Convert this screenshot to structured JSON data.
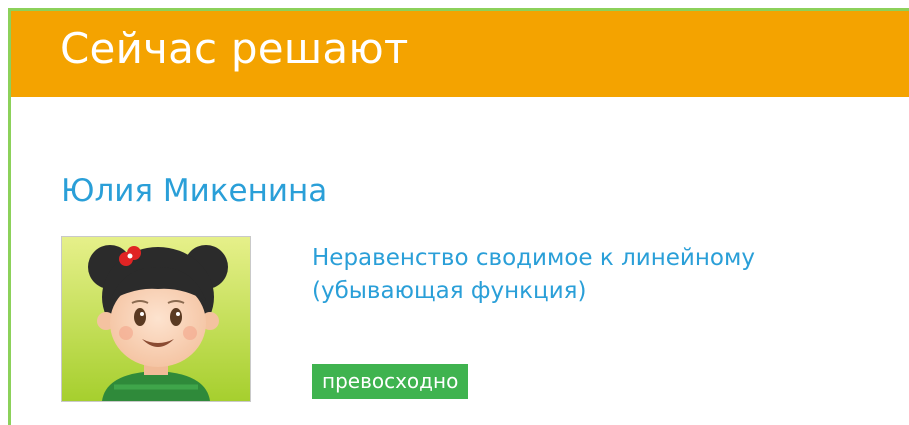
{
  "widget": {
    "title": "Сейчас решают"
  },
  "entry": {
    "user_name": "Юлия Микенина",
    "avatar_icon": "girl-avatar-icon",
    "task_title": "Неравенство сводимое к линейному (убывающая функция)",
    "grade": "превосходно"
  },
  "colors": {
    "header": "#f4a300",
    "border": "#8cd15a",
    "link": "#2a9fd8",
    "badge": "#3fb34f"
  }
}
